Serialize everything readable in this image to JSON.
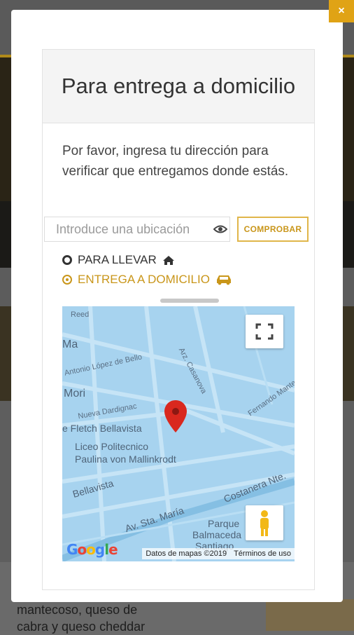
{
  "background": {
    "snippet_line1": "mantecoso, queso de",
    "snippet_line2": "cabra y queso cheddar"
  },
  "modal": {
    "close_label": "×",
    "title": "Para entrega a domicilio",
    "description": "Por favor, ingresa tu dirección para verificar que entregamos donde estás.",
    "location_input": {
      "placeholder": "Introduce una ubicación",
      "value": ""
    },
    "check_button": "COMPROBAR",
    "options": [
      {
        "label": "PARA LLEVAR",
        "icon": "home-icon",
        "selected": false
      },
      {
        "label": "ENTREGA A DOMICILIO",
        "icon": "car-icon",
        "selected": true
      }
    ],
    "accent_color": "#c9961a"
  },
  "map": {
    "labels": {
      "reed": "Reed",
      "ma": "Ma",
      "antonio": "Antonio López de Bello",
      "arz": "Arz. Casanova",
      "mori": "Mori",
      "nueva": "Nueva Dardignac",
      "fernando": "Fernando Manterola",
      "fletch": "e Fletch Bellavista",
      "liceo1": "Liceo Politecnico",
      "liceo2": "Paulina von Mallinkrodt",
      "bellavista": "Bellavista",
      "costanera": "Costanera Nte.",
      "sta_maria": "Av. Sta. María",
      "parque1": "Parque",
      "parque2": "Balmaceda",
      "parque3": "Santiago"
    },
    "google": "Google",
    "attribution": "Datos de mapas ©2019",
    "terms": "Términos de uso"
  }
}
